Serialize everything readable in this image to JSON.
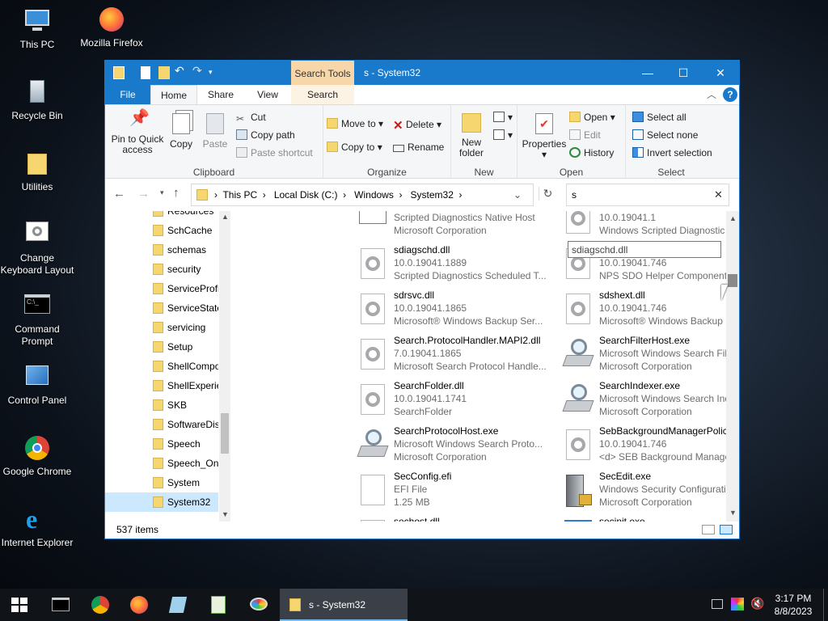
{
  "desktop": {
    "icons": [
      {
        "label": "This PC"
      },
      {
        "label": "Mozilla Firefox"
      },
      {
        "label": "Recycle Bin"
      },
      {
        "label": "Utilities"
      },
      {
        "label": "Change Keyboard Layout"
      },
      {
        "label": "Command Prompt"
      },
      {
        "label": "Control Panel"
      },
      {
        "label": "Google Chrome"
      },
      {
        "label": "Internet Explorer"
      }
    ]
  },
  "window": {
    "title": "s - System32",
    "context_tab": "Search Tools",
    "minimize": "—",
    "maximize": "☐",
    "close": "✕"
  },
  "tabs": [
    "File",
    "Home",
    "Share",
    "View",
    "Search"
  ],
  "ribbon": {
    "clipboard": {
      "label": "Clipboard",
      "pin": "Pin to Quick access",
      "copy": "Copy",
      "paste": "Paste",
      "cut": "Cut",
      "copy_path": "Copy path",
      "paste_shortcut": "Paste shortcut"
    },
    "organize": {
      "label": "Organize",
      "move_to": "Move to",
      "copy_to": "Copy to",
      "delete": "Delete",
      "rename": "Rename"
    },
    "new": {
      "label": "New",
      "new_folder": "New folder"
    },
    "open": {
      "label": "Open",
      "properties": "Properties",
      "open": "Open",
      "edit": "Edit",
      "history": "History"
    },
    "select": {
      "label": "Select",
      "select_all": "Select all",
      "select_none": "Select none",
      "invert": "Invert selection"
    }
  },
  "address": {
    "crumbs": [
      "This PC",
      "Local Disk (C:)",
      "Windows",
      "System32"
    ],
    "search_value": "s"
  },
  "nav": {
    "items": [
      "Resources",
      "SchCache",
      "schemas",
      "security",
      "ServiceProfi",
      "ServiceState",
      "servicing",
      "Setup",
      "ShellCompo",
      "ShellExperie",
      "SKB",
      "SoftwareDis",
      "Speech",
      "Speech_One",
      "System",
      "System32"
    ]
  },
  "files": [
    {
      "name": "",
      "line2": "Scripted Diagnostics Native Host",
      "line3": "Microsoft Corporation"
    },
    {
      "name": "",
      "line2": "10.0.19041.1",
      "line3": "Windows Scripted Diagnostic Pro..."
    },
    {
      "name": "sdiagschd.dll",
      "line2": "10.0.19041.1889",
      "line3": "Scripted Diagnostics Scheduled T..."
    },
    {
      "name": "sdohlp.dll",
      "line2": "10.0.19041.746",
      "line3": "NPS SDO Helper Component"
    },
    {
      "name": "sdrsvc.dll",
      "line2": "10.0.19041.1865",
      "line3": "Microsoft® Windows Backup Ser..."
    },
    {
      "name": "sdshext.dll",
      "line2": "10.0.19041.746",
      "line3": "Microsoft® Windows Backup She..."
    },
    {
      "name": "Search.ProtocolHandler.MAPI2.dll",
      "line2": "7.0.19041.1865",
      "line3": "Microsoft Search Protocol Handle..."
    },
    {
      "name": "SearchFilterHost.exe",
      "line2": "Microsoft Windows Search Filter ...",
      "line3": "Microsoft Corporation"
    },
    {
      "name": "SearchFolder.dll",
      "line2": "10.0.19041.1741",
      "line3": "SearchFolder"
    },
    {
      "name": "SearchIndexer.exe",
      "line2": "Microsoft Windows Search Indexer",
      "line3": "Microsoft Corporation"
    },
    {
      "name": "SearchProtocolHost.exe",
      "line2": "Microsoft Windows Search Proto...",
      "line3": "Microsoft Corporation"
    },
    {
      "name": "SebBackgroundManagerPolicy.dll",
      "line2": "10.0.19041.746",
      "line3": "<d> SEB Background Manager P..."
    },
    {
      "name": "SecConfig.efi",
      "line2": "EFI File",
      "line3": "1.25 MB"
    },
    {
      "name": "SecEdit.exe",
      "line2": "Windows Security Configuration ...",
      "line3": "Microsoft Corporation"
    },
    {
      "name": "sechost.dll",
      "line2": "",
      "line3": ""
    },
    {
      "name": "secinit.exe",
      "line2": "",
      "line3": ""
    }
  ],
  "tooltip": "sdiagschd.dll",
  "status": {
    "count": "537 items"
  },
  "taskbar": {
    "active_label": "s - System32",
    "time": "3:17 PM",
    "date": "8/8/2023"
  }
}
